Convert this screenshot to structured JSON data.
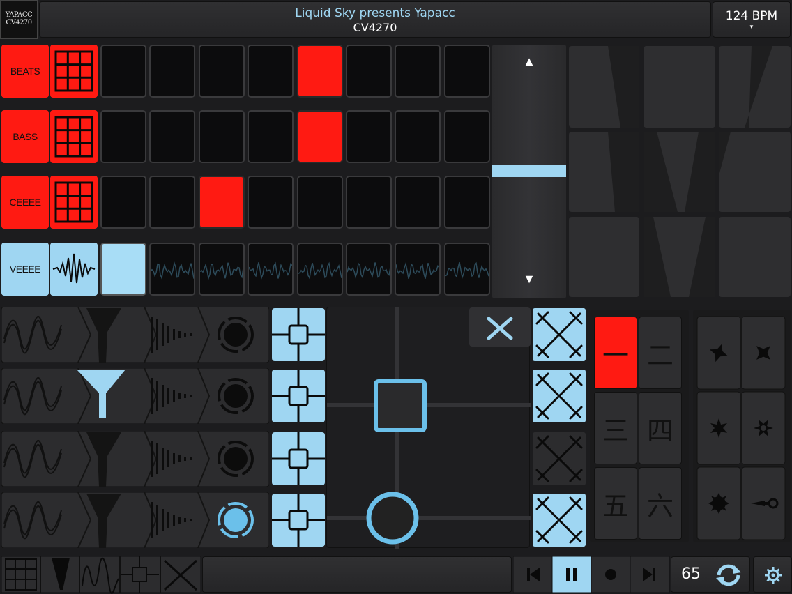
{
  "header": {
    "logo_line1": "YAPACC",
    "logo_line2": "CV4270",
    "title": "Liquid Sky presents Yapacc",
    "subtitle": "CV4270",
    "bpm_label": "124 BPM"
  },
  "tracks": [
    {
      "label": "BEATS",
      "active_step": 4
    },
    {
      "label": "BASS",
      "active_step": 4
    },
    {
      "label": "CEEEE",
      "active_step": 2
    },
    {
      "label": "VEEEE",
      "active_step": 0
    }
  ],
  "scroll": {
    "up_icon": "▲",
    "down_icon": "▼"
  },
  "pads_bank": [
    "一",
    "二",
    "三",
    "四",
    "五",
    "六"
  ],
  "transport": {
    "counter": "65"
  },
  "colors": {
    "accent_red": "#ff1a12",
    "accent_blue": "#9fd6f2"
  }
}
